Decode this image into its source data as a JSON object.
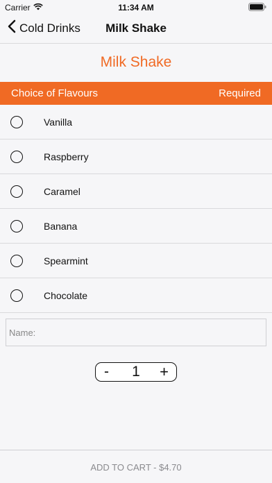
{
  "status_bar": {
    "carrier": "Carrier",
    "time": "11:34 AM",
    "icons": [
      "wifi-icon",
      "battery-icon"
    ]
  },
  "nav": {
    "back_label": "Cold Drinks",
    "back_icon": "chevron-left-icon",
    "title": "Milk Shake"
  },
  "product": {
    "title": "Milk Shake"
  },
  "section": {
    "title": "Choice of Flavours",
    "required_label": "Required"
  },
  "options": [
    {
      "label": "Vanilla"
    },
    {
      "label": "Raspberry"
    },
    {
      "label": "Caramel"
    },
    {
      "label": "Banana"
    },
    {
      "label": "Spearmint"
    },
    {
      "label": "Chocolate"
    }
  ],
  "name_field": {
    "placeholder": "Name:",
    "value": ""
  },
  "stepper": {
    "minus": "-",
    "quantity": "1",
    "plus": "+"
  },
  "cart": {
    "button_label": "ADD TO CART - $4.70"
  },
  "colors": {
    "accent": "#f06a24",
    "background": "#f6f6f8",
    "separator": "#d9d9dc",
    "disabled_text": "#8a8a8e"
  }
}
